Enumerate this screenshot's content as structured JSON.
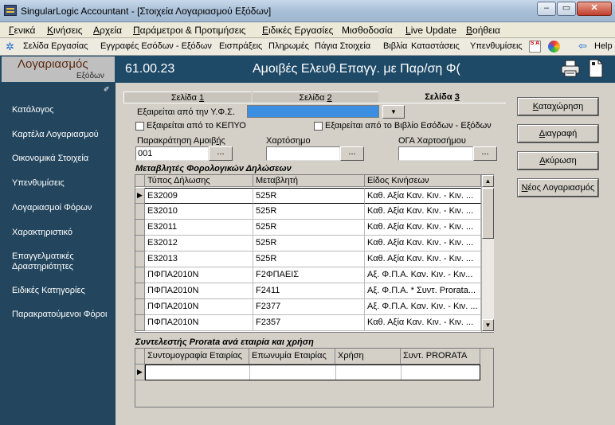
{
  "window": {
    "title": "SingularLogic Accountant - [Στοιχεία Λογαριασμού Εξόδων]",
    "min": "–",
    "max": "▭",
    "close": "✕"
  },
  "menu": [
    {
      "u": "Γ",
      "rest": "ενικά"
    },
    {
      "u": "Κ",
      "rest": "ινήσεις"
    },
    {
      "u": "Α",
      "rest": "ρχεία"
    },
    {
      "u": "Π",
      "rest": "αράμετροι & Προτιμήσεις"
    },
    {
      "u": "Ε",
      "rest": "ιδικές Εργασίες"
    },
    {
      "u": "",
      "rest": "Μισθοδοσία"
    },
    {
      "u": "L",
      "rest": "ive Update"
    },
    {
      "u": "Β",
      "rest": "οήθεια"
    }
  ],
  "toolbar": {
    "items": [
      "Σελίδα Εργασίας",
      "Εγγραφές Εσόδων - Εξόδων",
      "Εισπράξεις",
      "Πληρωμές",
      "Πάγια Στοιχεία",
      "Βιβλία",
      "Καταστάσεις",
      "Υπενθυμίσεις"
    ],
    "sa_logo": "S A",
    "help": "Help",
    "icons": {
      "gear": "gear-icon",
      "back": "arrow-left-icon"
    }
  },
  "header": {
    "left_title": "Λογαριασμός",
    "left_sub": "Εξόδων",
    "code": "61.00.23",
    "title": "Αμοιβές Ελευθ.Επαγγ. με Παρ/ση Φ("
  },
  "sidebar": {
    "pin": "✐",
    "items": [
      "Κατάλογος",
      "Καρτέλα Λογαριασμού",
      "Οικονομικά Στοιχεία",
      "Υπενθυμίσεις",
      "Λογαριασμοί Φόρων",
      "Χαρακτηριστικό",
      "Επαγγελματικές Δραστηριότητες",
      "Ειδικές Κατηγορίες",
      "Παρακρατούμενοι Φόροι"
    ]
  },
  "tabs": [
    {
      "pre": "Σελίδα ",
      "u": "1"
    },
    {
      "pre": "Σελίδα ",
      "u": "2"
    },
    {
      "pre": "Σελίδα ",
      "u": "3"
    }
  ],
  "form": {
    "yfs_label": "Εξαιρείται από την Υ.Φ.Σ.",
    "kepyo_label": "Εξαιρείται από το ΚΕΠΥΟ",
    "book_label": "Εξαιρείται από το Βιβλίο Εσόδων - Εξόδων",
    "withholding_label_pre": "Παρακράτηση Αμοιβ",
    "withholding_label_u": "ή",
    "withholding_label_post": "ς",
    "withholding_value": "001",
    "stamp_label": "Χαρτόσημο",
    "stamp_value": "",
    "oga_label": "ΟΓΑ Χαρτοσήμου",
    "oga_value": "",
    "ellipsis": "...",
    "dd_arrow": "▼"
  },
  "tax_grid": {
    "title": "Μεταβλητές Φορολογικών Δηλώσεων",
    "headers": [
      "Τύπος Δήλωσης",
      "Μεταβλητή",
      "Είδος Κινήσεων"
    ],
    "rows": [
      [
        "Ε32009",
        "525R",
        "Καθ. Αξία Καν. Κιν. - Κιν. ..."
      ],
      [
        "Ε32010",
        "525R",
        "Καθ. Αξία Καν. Κιν. - Κιν. ..."
      ],
      [
        "Ε32011",
        "525R",
        "Καθ. Αξία Καν. Κιν. - Κιν. ..."
      ],
      [
        "Ε32012",
        "525R",
        "Καθ. Αξία Καν. Κιν. - Κιν. ..."
      ],
      [
        "Ε32013",
        "525R",
        "Καθ. Αξία Καν. Κιν. - Κιν. ..."
      ],
      [
        "ΠΦΠΑ2010Ν",
        "F2ΦΠΑΕΙΣ",
        "Αξ. Φ.Π.Α. Καν. Κιν. - Κιν..."
      ],
      [
        "ΠΦΠΑ2010Ν",
        "F2411",
        "Αξ. Φ.Π.Α. * Συντ. Prorata..."
      ],
      [
        "ΠΦΠΑ2010Ν",
        "F2377",
        "Αξ. Φ.Π.Α. Καν. Κιν. - Κιν. ..."
      ],
      [
        "ΠΦΠΑ2010Ν",
        "F2357",
        "Καθ. Αξία Καν. Κιν. - Κιν. ..."
      ]
    ],
    "current_marker": "▶",
    "scroll_up": "▲",
    "scroll_down": "▼"
  },
  "prorata_grid": {
    "title": "Συντελεστής Prorata ανά εταιρία και χρήση",
    "headers": [
      "Συντομογραφία Εταιρίας",
      "Επωνυμία Εταιρίας",
      "Χρήση",
      "Συντ. PRORATA"
    ],
    "current_marker": "▶"
  },
  "buttons": [
    {
      "u": "Κ",
      "rest": "αταχώρηση",
      "pos": "pre"
    },
    {
      "u": "Δ",
      "rest": "ιαγραφή",
      "pos": "pre"
    },
    {
      "u": "Α",
      "rest": "κύρωση",
      "pos": "pre"
    },
    {
      "u": "Ν",
      "rest": "έος Λογαριασμός",
      "pos": "pre"
    }
  ]
}
